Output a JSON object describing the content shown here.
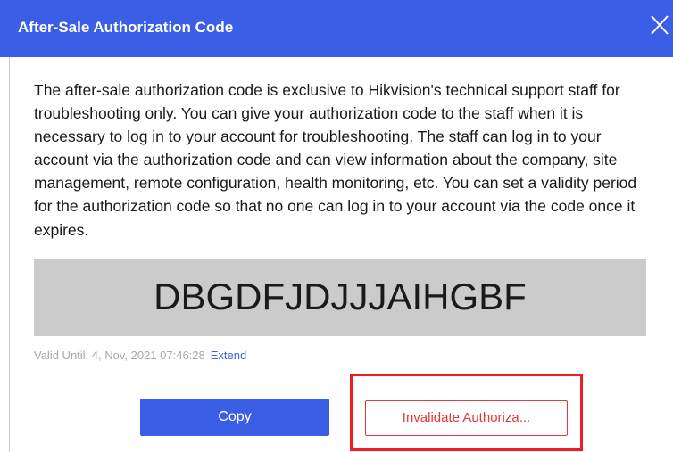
{
  "dialog": {
    "title": "After-Sale Authorization Code",
    "close_icon": "close-icon",
    "description": "The after-sale authorization code is exclusive to Hikvision's technical support staff for troubleshooting only. You can give your authorization code to the staff when it is necessary to log in to your account for troubleshooting. The staff can log in to your account via the authorization code and can view information about the company, site management, remote configuration, health monitoring, etc. You can set a validity period for the authorization code so that no one can log in to your account via the code once it expires.",
    "authorization_code": "DBGDFJDJJJAIHGBF",
    "valid_until": "Valid Until: 4, Nov, 2021 07:46:28",
    "extend_label": "Extend",
    "copy_label": "Copy",
    "invalidate_label": "Invalidate Authoriza..."
  },
  "colors": {
    "primary": "#3b5ee6",
    "danger": "#e0393e",
    "highlight": "#ee1c24",
    "code_bg": "#cbcbcb"
  }
}
